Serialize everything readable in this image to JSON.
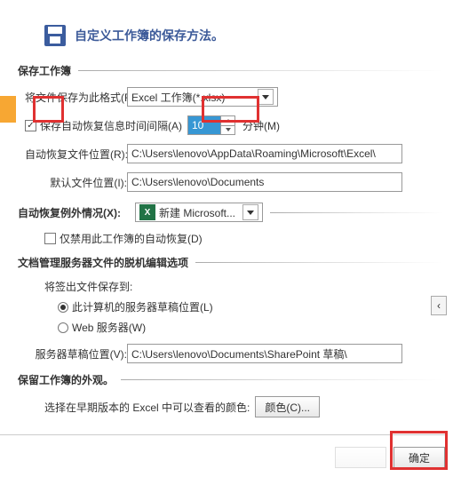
{
  "header": {
    "title": "自定义工作簿的保存方法。"
  },
  "sections": {
    "save_workbook": "保存工作簿",
    "auto_recover_exceptions": "自动恢复例外情况(X):",
    "doc_mgmt_server": "文档管理服务器文件的脱机编辑选项",
    "preserve_appearance": "保留工作簿的外观。"
  },
  "labels": {
    "save_format": "将文件保存为此格式(F):",
    "auto_save_interval": "保存自动恢复信息时间间隔(A)",
    "minutes": "分钟(M)",
    "auto_recover_location": "自动恢复文件位置(R):",
    "default_location": "默认文件位置(I):",
    "disable_auto_recover": "仅禁用此工作簿的自动恢复(D)",
    "save_checkout_to": "将签出文件保存到:",
    "this_computer_drafts": "此计算机的服务器草稿位置(L)",
    "web_server": "Web 服务器(W)",
    "server_drafts_location": "服务器草稿位置(V):",
    "earlier_version_colors": "选择在早期版本的 Excel 中可以查看的颜色:",
    "color_button": "颜色(C)...",
    "new_microsoft": "新建 Microsoft...",
    "ok_button": "确定"
  },
  "values": {
    "format_value": "Excel 工作簿(*.xlsx)",
    "interval": "10",
    "recover_path": "C:\\Users\\lenovo\\AppData\\Roaming\\Microsoft\\Excel\\",
    "default_path": "C:\\Users\\lenovo\\Documents",
    "drafts_path": "C:\\Users\\lenovo\\Documents\\SharePoint 草稿\\"
  },
  "checkboxes": {
    "auto_save_checked": true,
    "disable_auto_recover_checked": false
  },
  "radios": {
    "this_computer_selected": true,
    "web_server_selected": false
  }
}
